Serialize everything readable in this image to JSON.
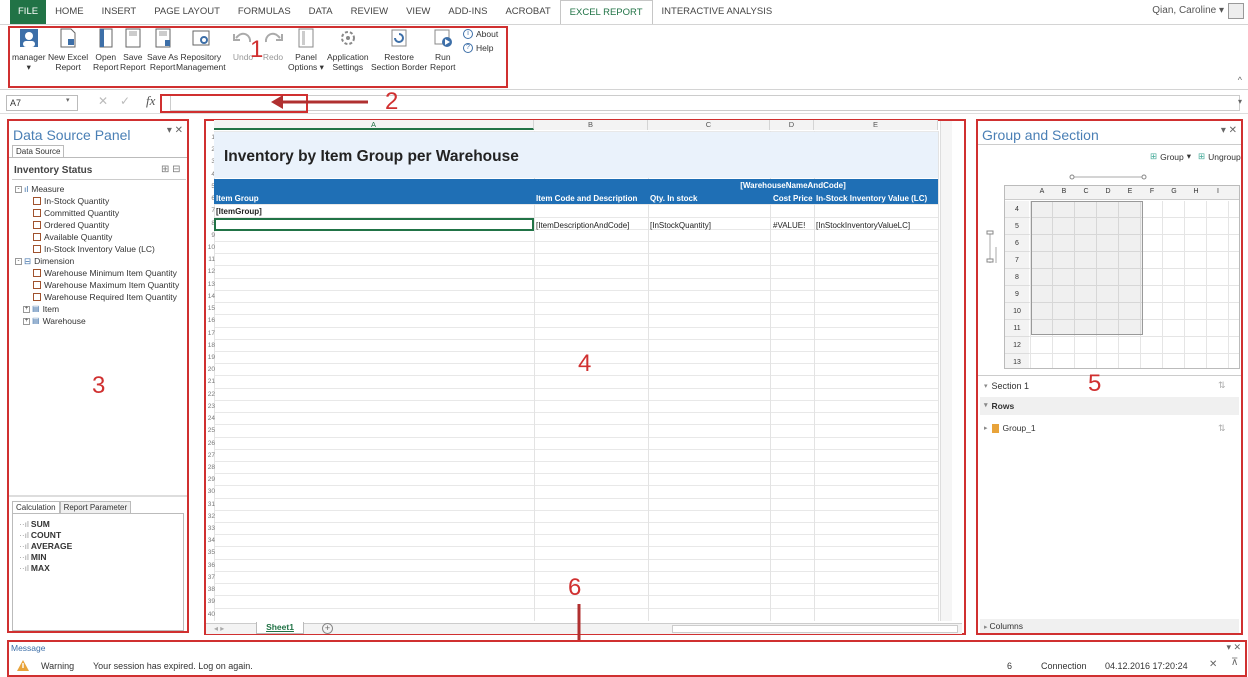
{
  "tabs": [
    "FILE",
    "HOME",
    "INSERT",
    "PAGE LAYOUT",
    "FORMULAS",
    "DATA",
    "REVIEW",
    "VIEW",
    "ADD-INS",
    "ACROBAT",
    "EXCEL REPORT",
    "INTERACTIVE ANALYSIS"
  ],
  "user": "Qian, Caroline",
  "ribbon": {
    "manager": "manager",
    "new_report": [
      "New Excel",
      "Report"
    ],
    "open": [
      "Open",
      "Report"
    ],
    "save": [
      "Save",
      "Report"
    ],
    "save_as": [
      "Save As",
      "Report"
    ],
    "repository": [
      "Repository",
      "Management"
    ],
    "undo": "Undo",
    "redo": "Redo",
    "panel": [
      "Panel",
      "Options"
    ],
    "app_settings": [
      "Application",
      "Settings"
    ],
    "restore": [
      "Restore",
      "Section Border"
    ],
    "run": [
      "Run",
      "Report"
    ],
    "about": "About",
    "help": "Help"
  },
  "namebox": "A7",
  "fx": "fx",
  "markers": [
    "1",
    "2",
    "3",
    "4",
    "5",
    "6"
  ],
  "dsp": {
    "title": "Data Source Panel",
    "tab": "Data Source",
    "subtitle": "Inventory Status",
    "measure_label": "Measure",
    "measures": [
      "In-Stock Quantity",
      "Committed Quantity",
      "Ordered Quantity",
      "Available Quantity",
      "In-Stock Inventory Value (LC)"
    ],
    "dimension_label": "Dimension",
    "dimensions": [
      "Warehouse Minimum Item Quantity",
      "Warehouse Maximum Item Quantity",
      "Warehouse Required Item Quantity"
    ],
    "groups": [
      "Item",
      "Warehouse"
    ],
    "calc_tabs": [
      "Calculation",
      "Report Parameter"
    ],
    "calcs": [
      "SUM",
      "COUNT",
      "AVERAGE",
      "MIN",
      "MAX"
    ]
  },
  "sheet": {
    "cols": [
      "A",
      "B",
      "C",
      "D",
      "E"
    ],
    "title": "Inventory by Item Group per Warehouse",
    "wh_header": "[WarehouseNameAndCode]",
    "headers": [
      "Item Group",
      "Item Code and Description",
      "Qty. In stock",
      "Cost Price",
      "In-Stock Inventory Value (LC)"
    ],
    "group_cell": "[ItemGroup]",
    "row7": [
      "[ItemDescriptionAndCode]",
      "[InStockQuantity]",
      "#VALUE!",
      "[InStockInventoryValueLC]"
    ],
    "tab": "Sheet1"
  },
  "gs": {
    "title": "Group and Section",
    "group_btn": "Group",
    "ungroup_btn": "Ungroup",
    "mini_cols": [
      "A",
      "B",
      "C",
      "D",
      "E",
      "F",
      "G",
      "H",
      "I"
    ],
    "mini_rows": [
      "4",
      "5",
      "6",
      "7",
      "8",
      "9",
      "10",
      "11",
      "12",
      "13"
    ],
    "section": "Section 1",
    "rows_label": "Rows",
    "group_item": "Group_1",
    "columns_label": "Columns"
  },
  "message": {
    "title": "Message",
    "level": "Warning",
    "text": "Your session has expired. Log on again.",
    "count": "6",
    "source": "Connection",
    "time": "04.12.2016 17:20:24"
  }
}
